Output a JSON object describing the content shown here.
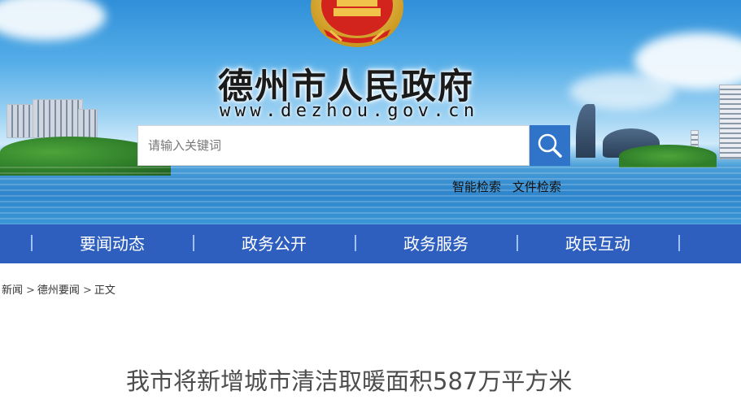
{
  "header": {
    "site_title": "德州市人民政府",
    "site_domain": "www.dezhou.gov.cn",
    "search": {
      "placeholder": "请输入关键词",
      "value": ""
    },
    "advanced_links": [
      {
        "label": "智能检索"
      },
      {
        "label": "文件检索"
      }
    ],
    "colors": {
      "search_button": "#2f74c8",
      "sky_top": "#2f8fd8"
    }
  },
  "nav": {
    "background": "#2e5fbe",
    "items": [
      {
        "label": "要闻动态"
      },
      {
        "label": "政务公开"
      },
      {
        "label": "政务服务"
      },
      {
        "label": "政民互动"
      },
      {
        "label": "走"
      }
    ]
  },
  "breadcrumb": [
    {
      "label": "新闻"
    },
    {
      "label": "德州要闻"
    },
    {
      "label": "正文"
    }
  ],
  "article": {
    "title": "我市将新增城市清洁取暖面积587万平方米"
  },
  "icons": {
    "search_button": "magnifier-icon",
    "emblem": "national-emblem-icon"
  }
}
